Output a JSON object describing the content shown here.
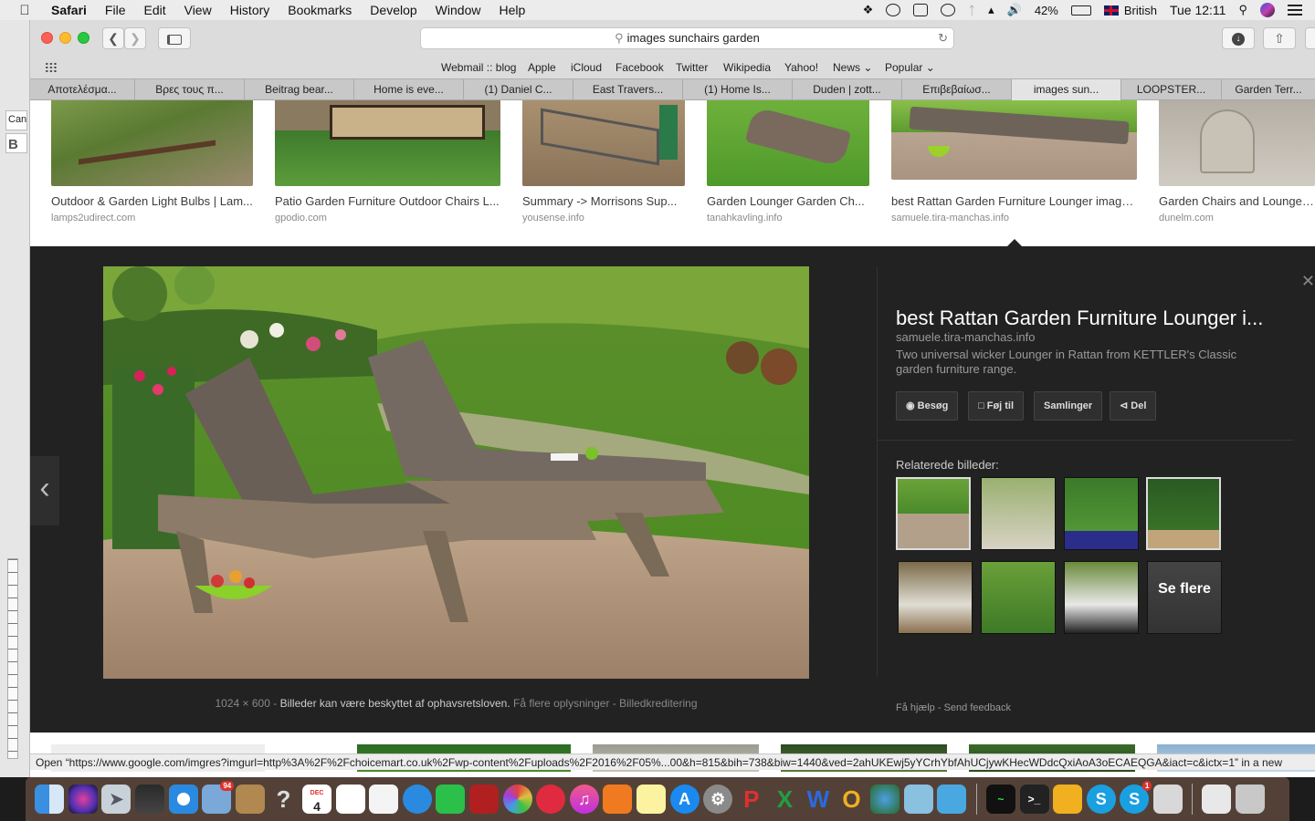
{
  "menubar": {
    "app": "Safari",
    "items": [
      "File",
      "Edit",
      "View",
      "History",
      "Bookmarks",
      "Develop",
      "Window",
      "Help"
    ],
    "battery": "42%",
    "input_source": "British",
    "clock": "Tue 12:11"
  },
  "toolbar": {
    "url": "images sunchairs garden"
  },
  "favorites": [
    "Webmail :: blog",
    "Apple",
    "iCloud",
    "Facebook",
    "Twitter",
    "Wikipedia",
    "Yahoo!",
    "News",
    "Popular"
  ],
  "tabs": [
    "Αποτελέσμα...",
    "Βρες τους π...",
    "Beitrag bear...",
    "Home is eve...",
    "(1) Daniel C...",
    "East Travers...",
    "(1) Home Is...",
    "Duden | zott...",
    "Επιβεβαίωσ...",
    "images sun...",
    "LOOPSTER...",
    "Garden Terr..."
  ],
  "results": [
    {
      "title": "Outdoor & Garden Light Bulbs | Lam...",
      "source": "lamps2udirect.com"
    },
    {
      "title": "Patio Garden Furniture Outdoor Chairs L...",
      "source": "gpodio.com"
    },
    {
      "title": "Summary -> Morrisons Sup...",
      "source": "yousense.info"
    },
    {
      "title": "Garden Lounger Garden Ch...",
      "source": "tanahkavling.info"
    },
    {
      "title": "best Rattan Garden Furniture Lounger image...",
      "source": "samuele.tira-manchas.info"
    },
    {
      "title": "Garden Chairs and Lounger...",
      "source": "dunelm.com"
    }
  ],
  "panel": {
    "title": "best Rattan Garden Furniture Lounger i...",
    "source": "samuele.tira-manchas.info",
    "description": "Two universal wicker Lounger in Rattan from KETTLER's Classic garden furniture range.",
    "buttons": {
      "visit": "Besøg",
      "save": "Føj til",
      "collections": "Samlinger",
      "share": "Del"
    },
    "related_heading": "Relaterede billeder:",
    "see_more": "Se flere",
    "size": "1024 × 600",
    "copyright": "Billeder kan være beskyttet af ophavsretsloven.",
    "more_info": "Få flere oplysninger",
    "credits": "Billedkreditering",
    "help": "Få hjælp",
    "feedback": "Send feedback"
  },
  "statusbar": "Open “https://www.google.com/imgres?imgurl=http%3A%2F%2Fchoicemart.co.uk%2Fwp-content%2Fuploads%2F2016%2F05%...00&h=815&bih=738&biw=1440&ved=2ahUKEwj5yYCrhYbfAhUCjywKHecWDdcQxiAoA3oECAEQGA&iact=c&ictx=1” in a new",
  "leftstrip": {
    "field1": "Can",
    "field2": "B"
  },
  "dock": {
    "calendar_month": "DEC",
    "calendar_day": "4",
    "mail_badge": "94",
    "skype_badge": "1"
  }
}
